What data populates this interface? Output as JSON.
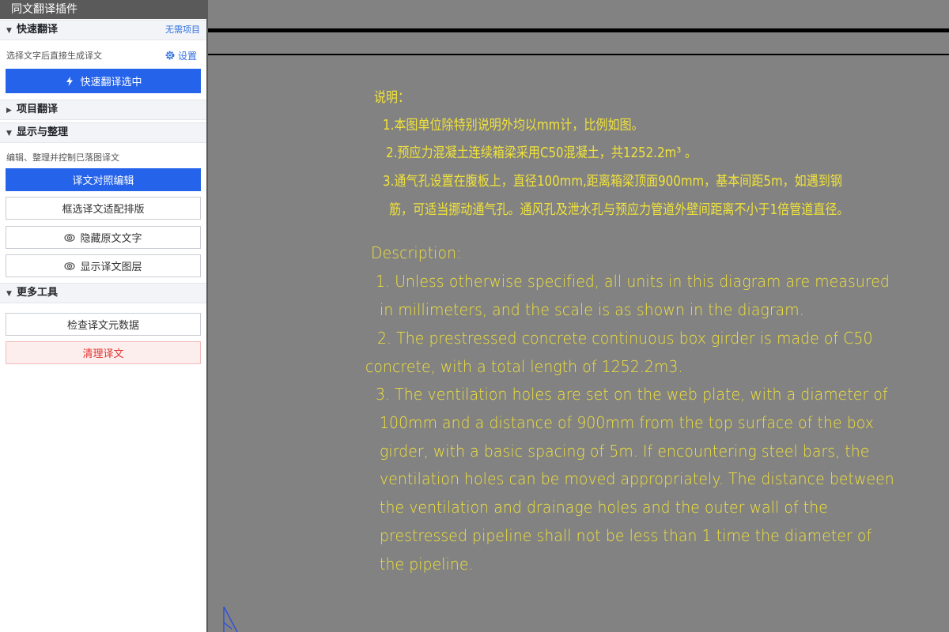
{
  "panel": {
    "title": "同文翻译插件",
    "quick": {
      "heading": "快速翻译",
      "aside": "无需项目",
      "hint": "选择文字后直接生成译文",
      "settings_label": "设置",
      "primary_button": "快速翻译选中"
    },
    "project": {
      "heading": "项目翻译"
    },
    "display": {
      "heading": "显示与整理",
      "hint": "编辑、整理并控制已落图译文",
      "buttons": [
        "译文对照编辑",
        "框选译文适配排版",
        "隐藏原文文字",
        "显示译文图层"
      ]
    },
    "more": {
      "heading": "更多工具",
      "buttons": [
        "检查译文元数据",
        "清理译文"
      ]
    }
  },
  "drawing": {
    "cn_lines": [
      "说明：",
      "1.本图单位除特别说明外均以mm计，比例如图。",
      "2.预应力混凝土连续箱梁采用C50混凝土，共1252.2m³ 。",
      "3.通气孔设置在腹板上，直径100mm,距离箱梁顶面900mm，基本间距5m，如遇到钢",
      "筋，可适当挪动通气孔。通风孔及泄水孔与预应力管道外壁间距离不小于1倍管道直径。"
    ],
    "en_lines": [
      "Description:",
      "1. Unless otherwise specified, all units in this diagram are measured",
      "in millimeters, and the scale is as shown in the diagram.",
      "2. The prestressed concrete continuous box girder is made of C50",
      "concrete, with a total length of 1252.2m3.",
      "3. The ventilation holes are set on the web plate, with a diameter of",
      "100mm and a distance of 900mm from the top surface of the box",
      "girder, with a basic spacing of 5m. If encountering steel bars, the",
      "ventilation holes can be moved appropriately. The distance between",
      "the ventilation and drainage holes and the outer wall of the",
      "prestressed pipeline shall not be less than 1 time the diameter of",
      "the pipeline."
    ],
    "text_color": "#f0e23a",
    "background_color": "#828282"
  },
  "colors": {
    "accent": "#2563eb",
    "danger": "#e0342f",
    "panel_header": "#5a5a5a"
  },
  "icons": [
    "chevron-down-icon",
    "chevron-right-icon",
    "gear-icon",
    "lightning-icon",
    "eye-icon",
    "ucs-icon"
  ]
}
